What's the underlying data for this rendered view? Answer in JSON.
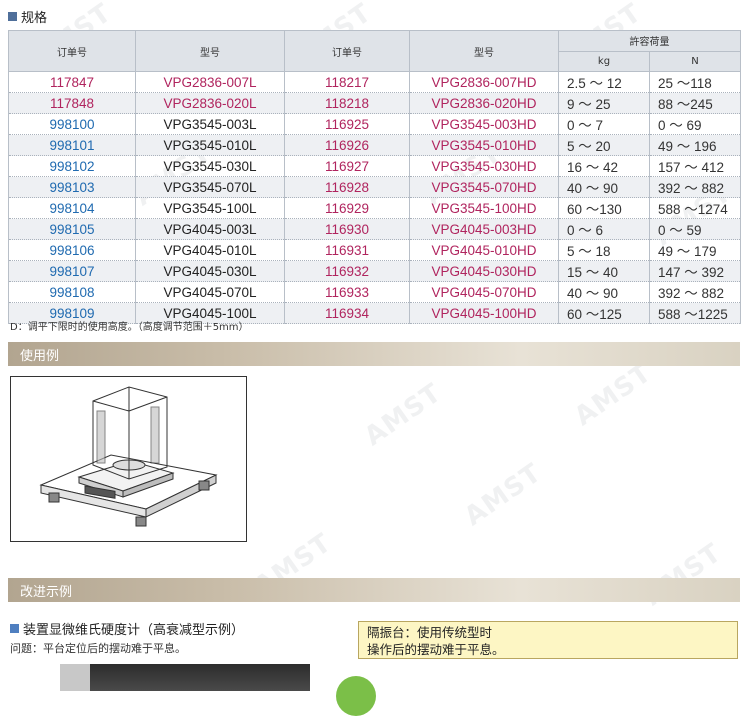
{
  "section_spec": {
    "title": "规格"
  },
  "table": {
    "headers": {
      "order1": "订单号",
      "model1": "型号",
      "order2": "订单号",
      "model2": "型号",
      "load": "許容荷量",
      "kg": "kg",
      "n": "N"
    },
    "rows": [
      {
        "o1": "117847",
        "m1": "VPG2836-007L",
        "o2": "118217",
        "m2": "VPG2836-007HD",
        "kg": "2.5 ～  12",
        "n": "25 ～118",
        "o1c": "mag",
        "m1c": "mag",
        "o2c": "mag",
        "m2c": "mag"
      },
      {
        "o1": "117848",
        "m1": "VPG2836-020L",
        "o2": "118218",
        "m2": "VPG2836-020HD",
        "kg": "9 ～  25",
        "n": "88 ～245",
        "o1c": "mag",
        "m1c": "mag",
        "o2c": "mag",
        "m2c": "mag"
      },
      {
        "o1": "998100",
        "m1": "VPG3545-003L",
        "o2": "116925",
        "m2": "VPG3545-003HD",
        "kg": "0 ～   7",
        "n": "0 ～   69",
        "o1c": "blue",
        "m1c": "dark",
        "o2c": "mag",
        "m2c": "mag"
      },
      {
        "o1": "998101",
        "m1": "VPG3545-010L",
        "o2": "116926",
        "m2": "VPG3545-010HD",
        "kg": "5 ～  20",
        "n": "49 ～ 196",
        "o1c": "blue",
        "m1c": "dark",
        "o2c": "mag",
        "m2c": "mag"
      },
      {
        "o1": "998102",
        "m1": "VPG3545-030L",
        "o2": "116927",
        "m2": "VPG3545-030HD",
        "kg": "16 ～  42",
        "n": "157 ～ 412",
        "o1c": "blue",
        "m1c": "dark",
        "o2c": "mag",
        "m2c": "mag"
      },
      {
        "o1": "998103",
        "m1": "VPG3545-070L",
        "o2": "116928",
        "m2": "VPG3545-070HD",
        "kg": "40 ～  90",
        "n": "392 ～ 882",
        "o1c": "blue",
        "m1c": "dark",
        "o2c": "mag",
        "m2c": "mag"
      },
      {
        "o1": "998104",
        "m1": "VPG3545-100L",
        "o2": "116929",
        "m2": "VPG3545-100HD",
        "kg": "60 ～130",
        "n": "588 ～1274",
        "o1c": "blue",
        "m1c": "dark",
        "o2c": "mag",
        "m2c": "mag"
      },
      {
        "o1": "998105",
        "m1": "VPG4045-003L",
        "o2": "116930",
        "m2": "VPG4045-003HD",
        "kg": "0 ～   6",
        "n": "0 ～   59",
        "o1c": "blue",
        "m1c": "dark",
        "o2c": "mag",
        "m2c": "mag"
      },
      {
        "o1": "998106",
        "m1": "VPG4045-010L",
        "o2": "116931",
        "m2": "VPG4045-010HD",
        "kg": "5 ～  18",
        "n": "49 ～ 179",
        "o1c": "blue",
        "m1c": "dark",
        "o2c": "mag",
        "m2c": "mag"
      },
      {
        "o1": "998107",
        "m1": "VPG4045-030L",
        "o2": "116932",
        "m2": "VPG4045-030HD",
        "kg": "15 ～  40",
        "n": "147 ～ 392",
        "o1c": "blue",
        "m1c": "dark",
        "o2c": "mag",
        "m2c": "mag"
      },
      {
        "o1": "998108",
        "m1": "VPG4045-070L",
        "o2": "116933",
        "m2": "VPG4045-070HD",
        "kg": "40 ～  90",
        "n": "392 ～ 882",
        "o1c": "blue",
        "m1c": "dark",
        "o2c": "mag",
        "m2c": "mag"
      },
      {
        "o1": "998109",
        "m1": "VPG4045-100L",
        "o2": "116934",
        "m2": "VPG4045-100HD",
        "kg": "60 ～125",
        "n": "588 ～1225",
        "o1c": "blue",
        "m1c": "dark",
        "o2c": "mag",
        "m2c": "mag"
      }
    ]
  },
  "note": "D：调平下限时的使用高度。（高度调节范围＋5mm）",
  "section_usage": {
    "title": "使用例"
  },
  "section_improve": {
    "title": "改进示例",
    "subtitle": "装置显微维氏硬度计（高衰减型示例）",
    "problem": "问题：平台定位后的摆动难于平息。"
  },
  "callout": {
    "line1": "隔振台：使用传统型时",
    "line2": "操作后的摆动难于平息。"
  },
  "watermark": "AMST",
  "colors": {
    "magenta": "#b0245e",
    "blue": "#1f6ab0",
    "header_bg": "#dfe3e8",
    "band": "#b2a590",
    "callout_bg": "#fdf6c4"
  }
}
